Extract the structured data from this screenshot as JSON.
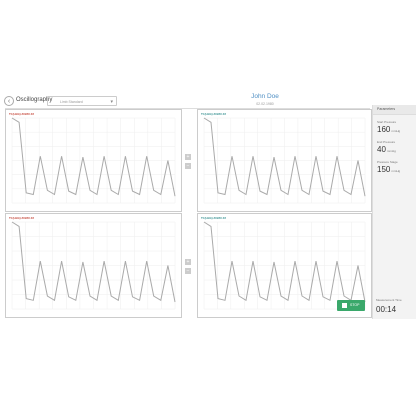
{
  "header": {
    "back_icon": "back-arrow-icon",
    "title": "Oscillography",
    "mode_select_value": "Limb Standard",
    "caret_icon": "chevron-down-icon"
  },
  "patient": {
    "name": "John Doe",
    "dob": "02.02.1980"
  },
  "panels": [
    {
      "lead": "TI (LEG) ##### ##",
      "color": "#c0392b"
    },
    {
      "lead": "TI (LEG) ##### ##",
      "color": "#2a8a8a"
    },
    {
      "lead": "TI (LEG) ##### ##",
      "color": "#c0392b"
    },
    {
      "lead": "TI (LEG) ##### ##",
      "color": "#2a8a8a"
    }
  ],
  "chart_data": [
    {
      "type": "line",
      "series": [
        {
          "values": [
            1.0,
            0.95,
            0.12,
            0.1,
            0.55,
            0.15,
            0.1,
            0.55,
            0.14,
            0.1,
            0.54,
            0.15,
            0.1,
            0.55,
            0.15,
            0.1,
            0.55,
            0.14,
            0.1,
            0.55,
            0.15,
            0.1,
            0.5,
            0.08
          ]
        }
      ]
    },
    {
      "type": "line",
      "series": [
        {
          "values": [
            1.0,
            0.95,
            0.12,
            0.1,
            0.55,
            0.15,
            0.1,
            0.55,
            0.14,
            0.1,
            0.54,
            0.15,
            0.1,
            0.55,
            0.15,
            0.1,
            0.55,
            0.14,
            0.1,
            0.55,
            0.15,
            0.1,
            0.5,
            0.08
          ]
        }
      ]
    },
    {
      "type": "line",
      "series": [
        {
          "values": [
            1.0,
            0.95,
            0.12,
            0.1,
            0.55,
            0.15,
            0.1,
            0.55,
            0.14,
            0.1,
            0.54,
            0.15,
            0.1,
            0.55,
            0.15,
            0.1,
            0.55,
            0.14,
            0.1,
            0.55,
            0.15,
            0.1,
            0.5,
            0.08
          ]
        }
      ]
    },
    {
      "type": "line",
      "series": [
        {
          "values": [
            1.0,
            0.95,
            0.12,
            0.1,
            0.55,
            0.15,
            0.1,
            0.55,
            0.14,
            0.1,
            0.54,
            0.15,
            0.1,
            0.55,
            0.15,
            0.1,
            0.55,
            0.14,
            0.1,
            0.55,
            0.15,
            0.1,
            0.5,
            0.08
          ]
        }
      ]
    }
  ],
  "controls": {
    "plus": "+",
    "minus": "−"
  },
  "sidebar": {
    "header": "Parameters",
    "start_pressure_label": "Start Pressure",
    "start_pressure_value": "160",
    "start_pressure_unit": "mmHg",
    "end_pressure_label": "End Pressure",
    "end_pressure_value": "40",
    "end_pressure_unit": "mmHg",
    "pressure_stage_label": "Pressure Stage",
    "pressure_stage_value": "150",
    "pressure_stage_unit": "mmHg"
  },
  "footer": {
    "stop_label": "STOP",
    "measurement_time_label": "Measurement Time",
    "measurement_time_value": "00:14"
  }
}
